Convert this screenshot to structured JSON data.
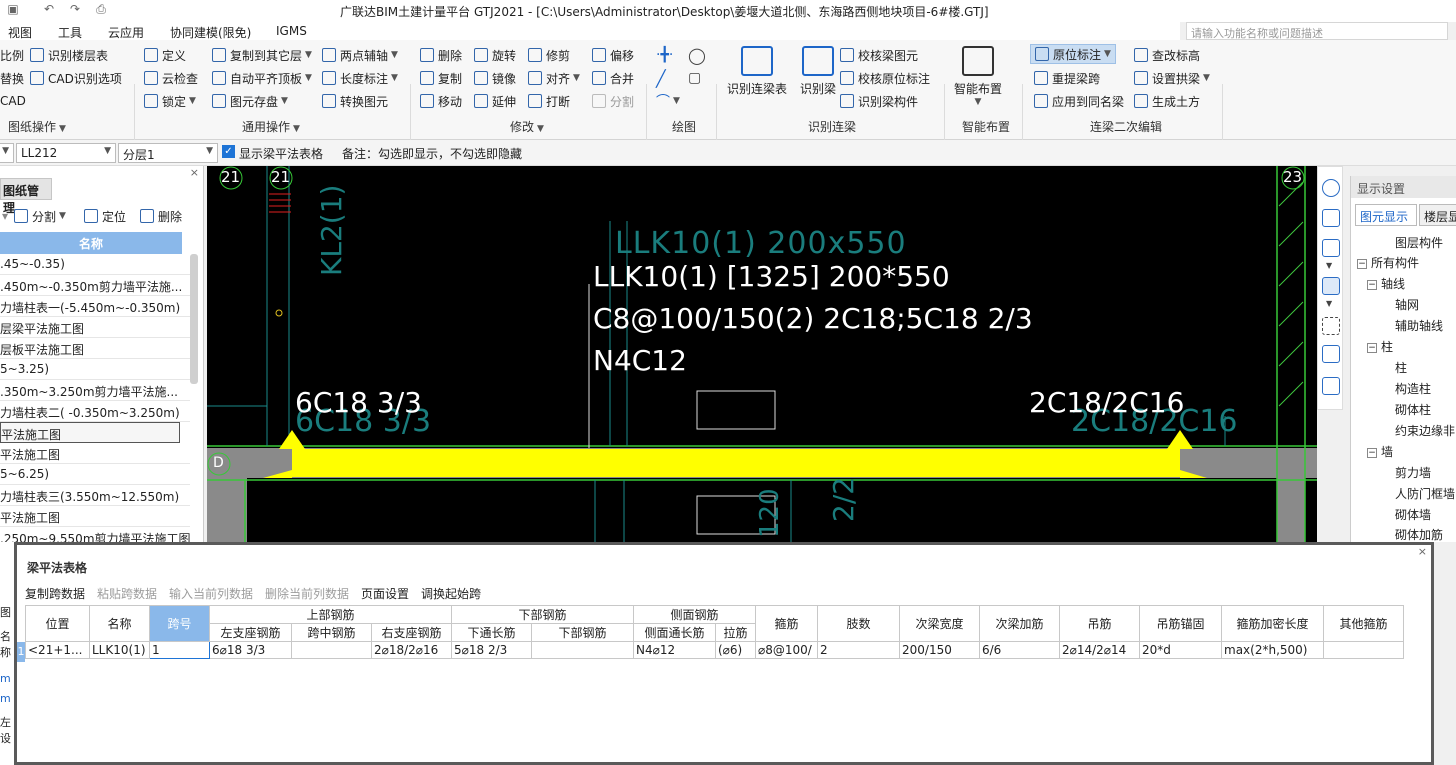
{
  "window": {
    "title": "广联达BIM土建计量平台 GTJ2021 - [C:\\Users\\Administrator\\Desktop\\姜堰大道北侧、东海路西侧地块项目-6#楼.GTJ]"
  },
  "search": {
    "placeholder": "请输入功能名称或问题描述"
  },
  "menu": [
    "视图",
    "工具",
    "云应用",
    "协同建模(限免)",
    "IGMS"
  ],
  "ribbon": {
    "g1": {
      "items": [
        "比例",
        "替换",
        "CAD",
        "识别楼层表",
        "CAD识别选项"
      ],
      "label": "图纸操作"
    },
    "g2": {
      "items": [
        "定义",
        "云检查",
        "锁定",
        "复制到其它层",
        "自动平齐顶板",
        "图元存盘",
        "两点辅轴",
        "长度标注",
        "转换图元"
      ],
      "label": "通用操作"
    },
    "g3": {
      "items": [
        "删除",
        "复制",
        "移动",
        "旋转",
        "镜像",
        "延伸",
        "修剪",
        "对齐",
        "打断",
        "偏移",
        "合并",
        "分割"
      ],
      "label": "修改"
    },
    "g4": {
      "label": "绘图"
    },
    "g5": {
      "items": [
        "识别连梁表",
        "识别梁",
        "校核梁图元",
        "校核原位标注",
        "识别梁构件"
      ],
      "label": "识别连梁"
    },
    "g6": {
      "items": [
        "智能布置"
      ],
      "label": "智能布置"
    },
    "g7": {
      "items": [
        "原位标注",
        "重提梁跨",
        "应用到同名梁",
        "查改标高",
        "设置拱梁",
        "生成土方"
      ],
      "label": "连梁二次编辑"
    }
  },
  "options": {
    "member": "LL212",
    "layer": "分层1",
    "show_table_label": "显示梁平法表格",
    "show_table_checked": true,
    "note": "备注：勾选即显示，不勾选即隐藏"
  },
  "left_panel": {
    "title": "图纸管理",
    "tools": [
      "分割",
      "定位",
      "删除"
    ],
    "column": "名称",
    "rows": [
      ".45~-0.35)",
      ".450m~-0.350m剪力墙平法施...",
      "力墙柱表一(-5.450m~-0.350m)",
      "层梁平法施工图",
      "层板平法施工图",
      "5~3.25)",
      ".350m~3.250m剪力墙平法施...",
      "力墙柱表二( -0.350m~3.250m)",
      "平法施工图",
      "平法施工图",
      "5~6.25)",
      "力墙柱表三(3.550m~12.550m)",
      "平法施工图",
      ".250m~9.550m剪力墙平法施工图"
    ],
    "selected_index": 8
  },
  "canvas": {
    "axes": [
      "21",
      "21",
      "23",
      "D",
      "D"
    ],
    "annotations": [
      "LLK10(1) [1325] 200*550",
      "C8@100/150(2) 2C18;5C18 2/3",
      "N4C12",
      "6C18 3/3",
      "2C18/2C16"
    ],
    "faint": [
      "LLK10(1) 200x550",
      "KL2(1)",
      "6C18 3/3",
      "2C18/2C16",
      "2/2",
      "120"
    ],
    "beam_color": "#ffff00"
  },
  "right_panel": {
    "title": "显示设置",
    "tabs": [
      "图元显示",
      "楼层显"
    ],
    "column": "图层构件",
    "tree": [
      "所有构件",
      "轴线",
      "轴网",
      "辅助轴线",
      "柱",
      "柱",
      "构造柱",
      "砌体柱",
      "约束边缘非",
      "墙",
      "剪力墙",
      "人防门框墙",
      "砌体墙",
      "砌体加筋"
    ]
  },
  "dialog": {
    "title": "梁平法表格",
    "tools": [
      "复制跨数据",
      "粘贴跨数据",
      "输入当前列数据",
      "删除当前列数据",
      "页面设置",
      "调换起始跨"
    ],
    "tools_disabled": [
      false,
      true,
      true,
      true,
      false,
      false
    ],
    "group_headers": [
      "上部钢筋",
      "下部钢筋",
      "侧面钢筋"
    ],
    "headers": [
      "位置",
      "名称",
      "跨号",
      "左支座钢筋",
      "跨中钢筋",
      "右支座钢筋",
      "下通长筋",
      "下部钢筋",
      "侧面通长筋",
      "拉筋",
      "箍筋",
      "肢数",
      "次梁宽度",
      "次梁加筋",
      "吊筋",
      "吊筋锚固",
      "箍筋加密长度",
      "其他箍筋"
    ],
    "row": [
      "<21+1...",
      "LLK10(1)",
      "1",
      "6⌀18 3/3",
      "",
      "2⌀18/2⌀16",
      "5⌀18 2/3",
      "",
      "N4⌀12",
      "(⌀6)",
      "⌀8@100/",
      "2",
      "200/150",
      "6/6",
      "2⌀14/2⌀14",
      "20*d",
      "max(2*h,500)",
      ""
    ],
    "row_index": "1"
  },
  "left_peek": [
    "图",
    "名称",
    "m",
    "m",
    "左设"
  ]
}
